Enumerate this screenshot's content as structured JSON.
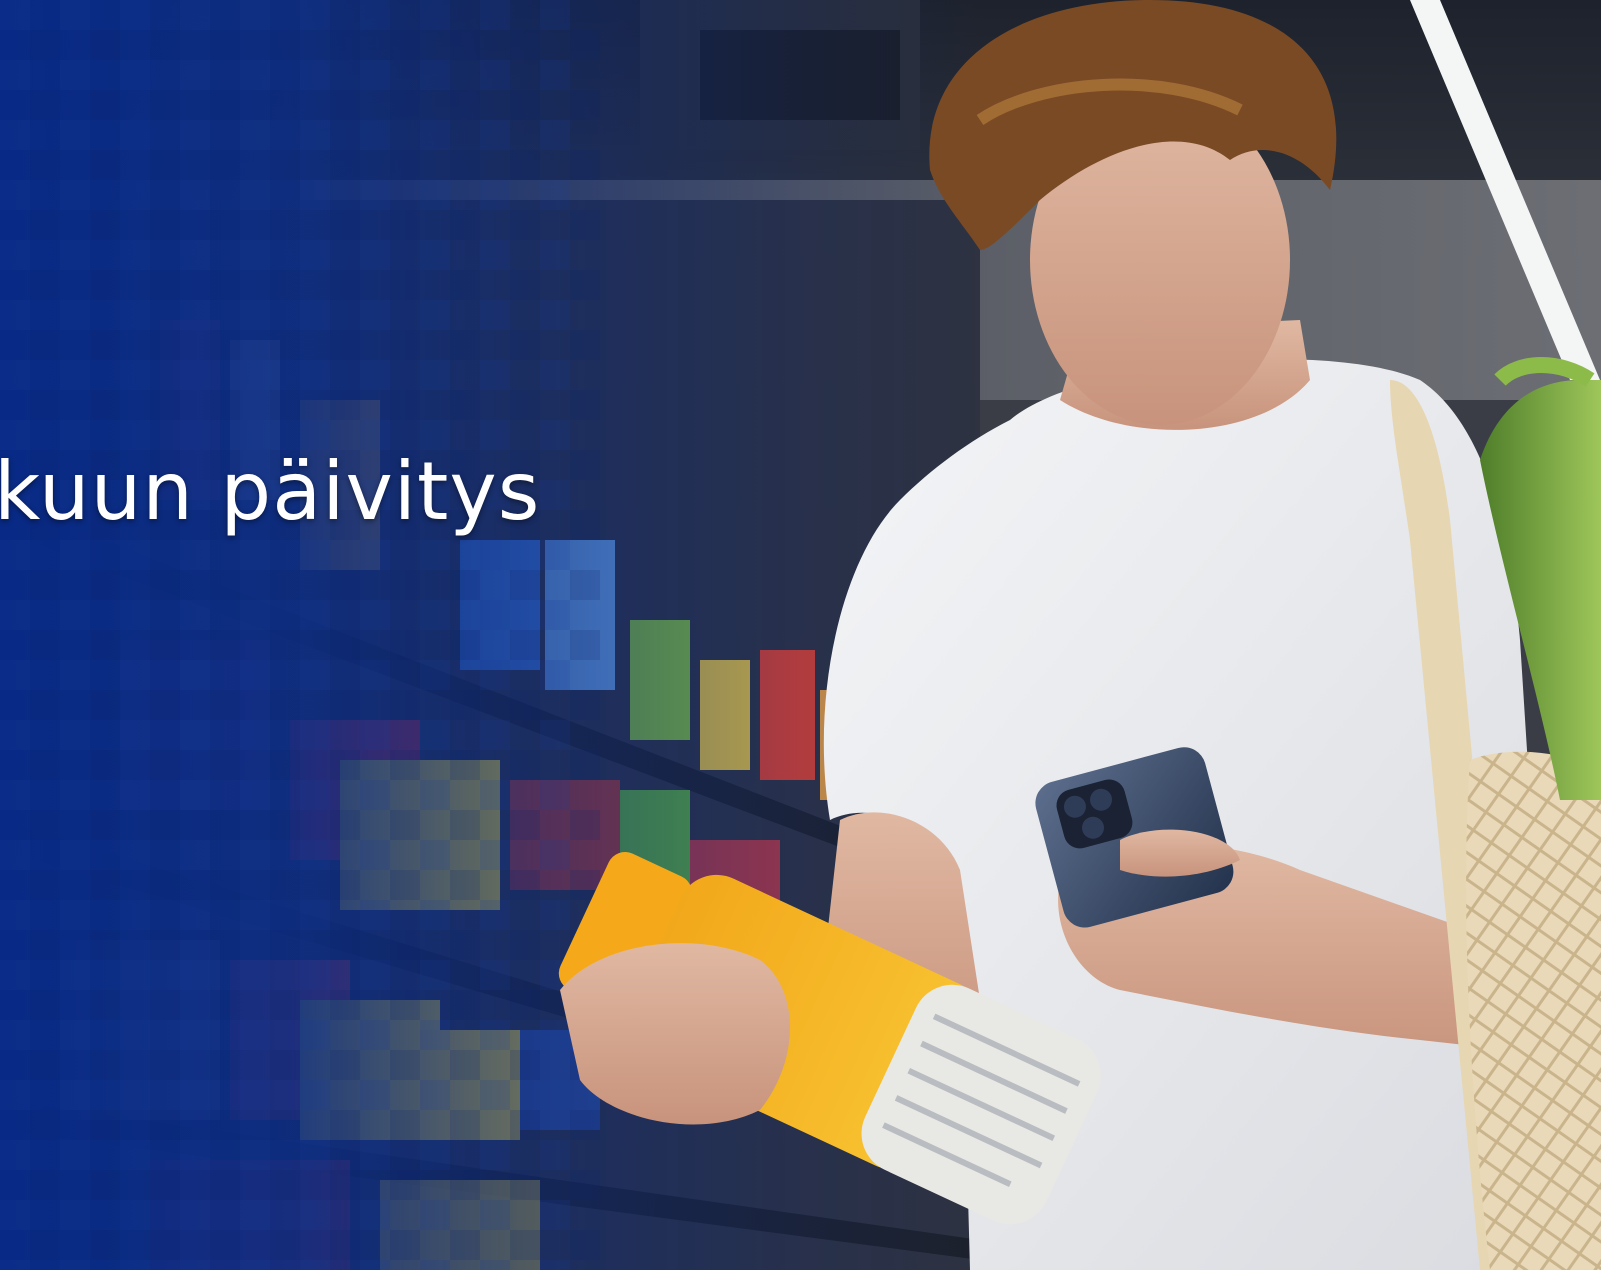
{
  "slide": {
    "headline": "kuun päivitys"
  },
  "colors": {
    "overlay_blue": "#0d2a7a",
    "overlay_edge": "#082060"
  }
}
